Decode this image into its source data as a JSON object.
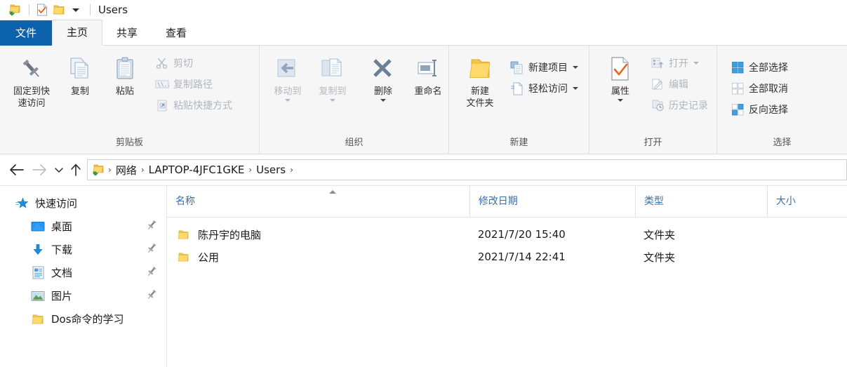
{
  "window": {
    "title": "Users",
    "quick_access_toolbar": [
      {
        "icon": "network-folder-icon",
        "name": "current-folder-icon"
      },
      {
        "icon": "properties-checkmark-icon",
        "name": "qat-properties"
      },
      {
        "icon": "new-folder-icon",
        "name": "qat-new-folder"
      },
      {
        "icon": "chevron-down-icon",
        "name": "qat-customize"
      }
    ]
  },
  "tabs": [
    {
      "label": "文件",
      "state": "file"
    },
    {
      "label": "主页",
      "state": "active"
    },
    {
      "label": "共享",
      "state": "normal"
    },
    {
      "label": "查看",
      "state": "normal"
    }
  ],
  "ribbon": {
    "groups": [
      {
        "label": "剪贴板",
        "big_buttons": [
          {
            "label": "固定到快\n速访问",
            "label_line1": "固定到快",
            "label_line2": "速访问",
            "icon": "pin-icon",
            "enabled": true
          },
          {
            "label": "复制",
            "icon": "copy-icon",
            "enabled": true
          },
          {
            "label": "粘贴",
            "icon": "paste-icon",
            "enabled": true
          }
        ],
        "small_buttons": [
          {
            "label": "剪切",
            "icon": "scissors-icon",
            "enabled": false
          },
          {
            "label": "复制路径",
            "icon": "copy-path-icon",
            "enabled": false
          },
          {
            "label": "粘贴快捷方式",
            "icon": "paste-shortcut-icon",
            "enabled": false
          }
        ]
      },
      {
        "label": "组织",
        "big_buttons": [
          {
            "label": "移动到",
            "icon": "move-to-icon",
            "enabled": false,
            "has_caret": true
          },
          {
            "label": "复制到",
            "icon": "copy-to-icon",
            "enabled": false,
            "has_caret": true
          },
          {
            "label": "删除",
            "icon": "delete-x-icon",
            "enabled": true,
            "has_caret": true
          },
          {
            "label": "重命名",
            "icon": "rename-icon",
            "enabled": true
          }
        ],
        "small_buttons": []
      },
      {
        "label": "新建",
        "big_buttons": [
          {
            "label_line1": "新建",
            "label_line2": "文件夹",
            "icon": "new-folder-icon",
            "enabled": true
          }
        ],
        "small_buttons": [
          {
            "label": "新建项目",
            "icon": "new-item-icon",
            "enabled": true,
            "has_caret": true
          },
          {
            "label": "轻松访问",
            "icon": "easy-access-icon",
            "enabled": true,
            "has_caret": true
          }
        ]
      },
      {
        "label": "打开",
        "big_buttons": [
          {
            "label": "属性",
            "icon": "properties-checkmark-icon",
            "enabled": true,
            "has_caret": true
          }
        ],
        "small_buttons": [
          {
            "label": "打开",
            "icon": "open-icon",
            "enabled": false,
            "has_caret": true
          },
          {
            "label": "编辑",
            "icon": "edit-icon",
            "enabled": false
          },
          {
            "label": "历史记录",
            "icon": "history-icon",
            "enabled": false
          }
        ]
      },
      {
        "label": "选择",
        "big_buttons": [],
        "small_buttons": [
          {
            "label": "全部选择",
            "icon": "select-all-icon",
            "enabled": true
          },
          {
            "label": "全部取消",
            "icon": "select-none-icon",
            "enabled": true
          },
          {
            "label": "反向选择",
            "icon": "invert-selection-icon",
            "enabled": true
          }
        ]
      }
    ]
  },
  "address_bar": {
    "back": {
      "name": "back-arrow-icon",
      "enabled": true
    },
    "forward": {
      "name": "forward-arrow-icon",
      "enabled": false
    },
    "recent": {
      "name": "chevron-down-icon",
      "enabled": true
    },
    "up": {
      "name": "up-arrow-icon",
      "enabled": true
    },
    "path_icon": "network-folder-icon",
    "breadcrumbs": [
      "网络",
      "LAPTOP-4JFC1GKE",
      "Users"
    ],
    "separator": "›"
  },
  "nav_pane": {
    "items": [
      {
        "label": "快速访问",
        "icon": "quick-access-star-icon",
        "level": 0,
        "pinned": false
      },
      {
        "label": "桌面",
        "icon": "desktop-icon",
        "level": 1,
        "pinned": true
      },
      {
        "label": "下载",
        "icon": "downloads-icon",
        "level": 1,
        "pinned": true
      },
      {
        "label": "文档",
        "icon": "documents-icon",
        "level": 1,
        "pinned": true
      },
      {
        "label": "图片",
        "icon": "pictures-icon",
        "level": 1,
        "pinned": true
      },
      {
        "label": "Dos命令的学习",
        "icon": "folder-icon",
        "level": 1,
        "pinned": false
      }
    ]
  },
  "file_list": {
    "columns": [
      {
        "label": "名称",
        "sorted": "asc"
      },
      {
        "label": "修改日期",
        "sorted": ""
      },
      {
        "label": "类型",
        "sorted": ""
      },
      {
        "label": "大小",
        "sorted": ""
      }
    ],
    "rows": [
      {
        "name": "陈丹宇的电脑",
        "modified": "2021/7/20 15:40",
        "type": "文件夹",
        "size": "",
        "icon": "folder-icon"
      },
      {
        "name": "公用",
        "modified": "2021/7/14 22:41",
        "type": "文件夹",
        "size": "",
        "icon": "folder-icon"
      }
    ]
  },
  "colors": {
    "accent": "#0b62ad",
    "ribbon_bg": "#f6f6f6",
    "column_header_text": "#3b6ea5",
    "folder_yellow": "#ffd966"
  }
}
